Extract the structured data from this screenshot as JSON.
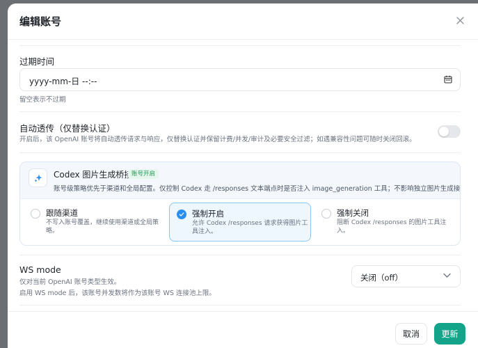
{
  "modal": {
    "title": "编辑账号"
  },
  "expiry": {
    "label": "过期时间",
    "placeholder": "yyyy-mm-日 --:--",
    "hint": "留空表示不过期"
  },
  "passthrough": {
    "label": "自动透传（仅替换认证）",
    "hint": "开启后，该 OpenAI 账号将自动透传请求与响应，仅替换认证并保留计费/并发/审计及必要安全过滤；如遇兼容性问题可随时关闭回滚。",
    "enabled": false
  },
  "codex": {
    "title": "Codex 图片生成桥接",
    "badge": "账号开启",
    "desc": "账号级策略优先于渠道和全局配置。仅控制 Codex 走 /responses 文本端点时是否注入 image_generation 工具；不影响独立图片生成接口。",
    "options": [
      {
        "title": "跟随渠道",
        "desc": "不写入账号覆盖，继续使用渠道或全局策略。",
        "selected": false
      },
      {
        "title": "强制开启",
        "desc": "允许 Codex /responses 请求获得图片工具注入。",
        "selected": true
      },
      {
        "title": "强制关闭",
        "desc": "阻断 Codex /responses 的图片工具注入。",
        "selected": false
      }
    ]
  },
  "ws": {
    "label": "WS mode",
    "hint1": "仅对当前 OpenAI 账号类型生效。",
    "hint2": "启用 WS mode 后，该账号并发数将作为该账号 WS 连接池上限。",
    "selected": "关闭（off）"
  },
  "footer": {
    "cancel": "取消",
    "update": "更新"
  },
  "colors": {
    "primary": "#14a48a",
    "radio_selected": "#2a8ef0",
    "badge_bg": "#e6f6ec",
    "badge_text": "#1f9a57"
  }
}
